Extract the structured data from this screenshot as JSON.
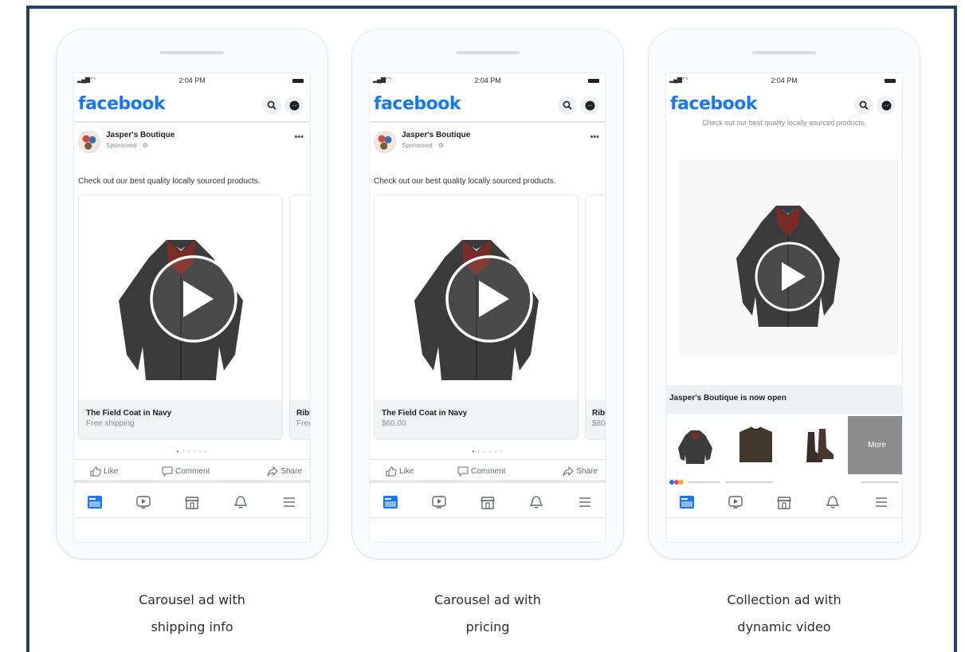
{
  "phones": [
    {
      "status_time": "2:04 PM",
      "brand": "facebook",
      "page_name": "Jasper's Boutique",
      "sponsored": "Sponsored · ⚙",
      "post_text": "Check out our best quality locally sourced products.",
      "card_title": "The Field Coat in Navy",
      "card_sub": "Free shipping",
      "card2_title": "Ribl",
      "card2_sub": "Free",
      "dots": "• • • • • •",
      "like": "Like",
      "comment": "Comment",
      "share": "Share",
      "caption_line1": "Carousel ad with",
      "caption_line2": "shipping info"
    },
    {
      "status_time": "2:04 PM",
      "brand": "facebook",
      "page_name": "Jasper's Boutique",
      "sponsored": "Sponsored · ⚙",
      "post_text": "Check out our best quality locally sourced products.",
      "card_title": "The Field Coat in Navy",
      "card_sub": "$60.00",
      "card2_title": "Ribl",
      "card2_sub": "$80",
      "dots": "• • • • • •",
      "like": "Like",
      "comment": "Comment",
      "share": "Share",
      "caption_line1": "Carousel ad with",
      "caption_line2": "pricing"
    },
    {
      "status_time": "2:04 PM",
      "brand": "facebook",
      "post_text_cut": "Check out our best quality locally sourced products.",
      "collection_title": "Jasper's Boutique is now open",
      "more_label": "More",
      "caption_line1": "Collection ad with",
      "caption_line2": "dynamic video"
    }
  ],
  "colors": {
    "facebook_blue": "#1877f2",
    "frame_border": "#1f3f6e"
  },
  "icons": [
    "search-icon",
    "messenger-icon",
    "play-icon",
    "like-icon",
    "comment-icon",
    "share-icon",
    "home-tab-icon",
    "watch-tab-icon",
    "marketplace-tab-icon",
    "notifications-tab-icon",
    "menu-tab-icon"
  ]
}
